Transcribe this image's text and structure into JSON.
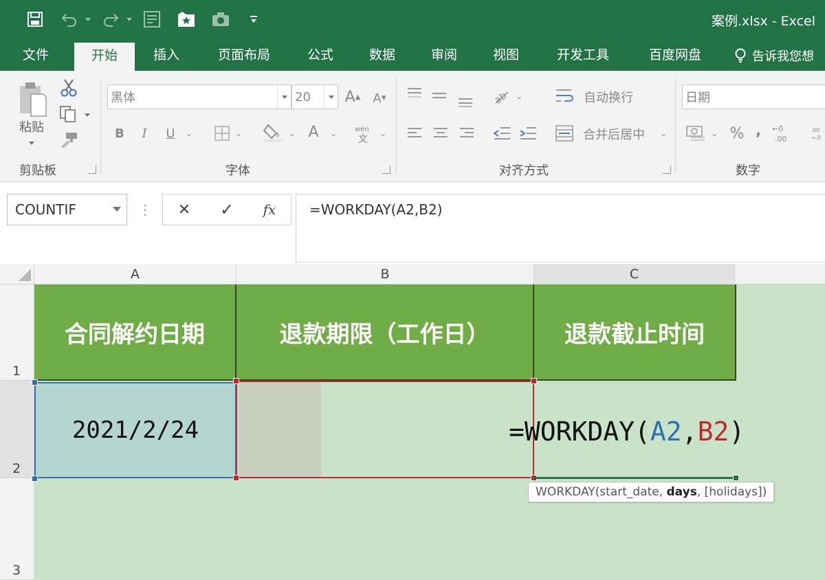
{
  "window": {
    "title": "案例.xlsx  -  Excel"
  },
  "quick_access": [
    "save-icon",
    "undo-icon",
    "redo-icon",
    "form-icon",
    "star-folder-icon",
    "camera-icon",
    "customize-icon"
  ],
  "ribbon_tabs": [
    "文件",
    "开始",
    "插入",
    "页面布局",
    "公式",
    "数据",
    "审阅",
    "视图",
    "开发工具",
    "百度网盘"
  ],
  "active_tab": "开始",
  "tell_me": "告诉我您想",
  "clipboard": {
    "paste_label": "粘贴",
    "group_label": "剪贴板"
  },
  "font": {
    "name": "黑体",
    "size": "20",
    "group_label": "字体"
  },
  "alignment": {
    "wrap_text": "自动换行",
    "merge_center": "合并后居中",
    "group_label": "对齐方式"
  },
  "number": {
    "format": "日期",
    "group_label": "数字",
    "percent": "%",
    "comma": ","
  },
  "formula_bar": {
    "name_box": "COUNTIF",
    "formula": "=WORKDAY(A2,B2)",
    "cancel_symbol": "✕",
    "enter_symbol": "✓",
    "fx_label": "fx"
  },
  "grid": {
    "columns": [
      "A",
      "B",
      "C"
    ],
    "rows": [
      "1",
      "2",
      "3"
    ],
    "headers": [
      "合同解约日期",
      "退款期限（工作日）",
      "退款截止时间"
    ],
    "cells": {
      "A2": "2021/2/24"
    },
    "editing": {
      "prefix": "=WORKDAY(",
      "ref_a": "A2",
      "separator": ",",
      "ref_b": "B2",
      "suffix": ")"
    },
    "tooltip": {
      "fn": "WORKDAY(start_date, ",
      "bold_arg": "days",
      "rest": ", [holidays])"
    }
  },
  "colors": {
    "excel_green": "#217346",
    "header_fill": "#70ad47",
    "sheet_background": "#c9e3c9",
    "ref_a": "#2f6fb5",
    "ref_b": "#c0282d"
  }
}
